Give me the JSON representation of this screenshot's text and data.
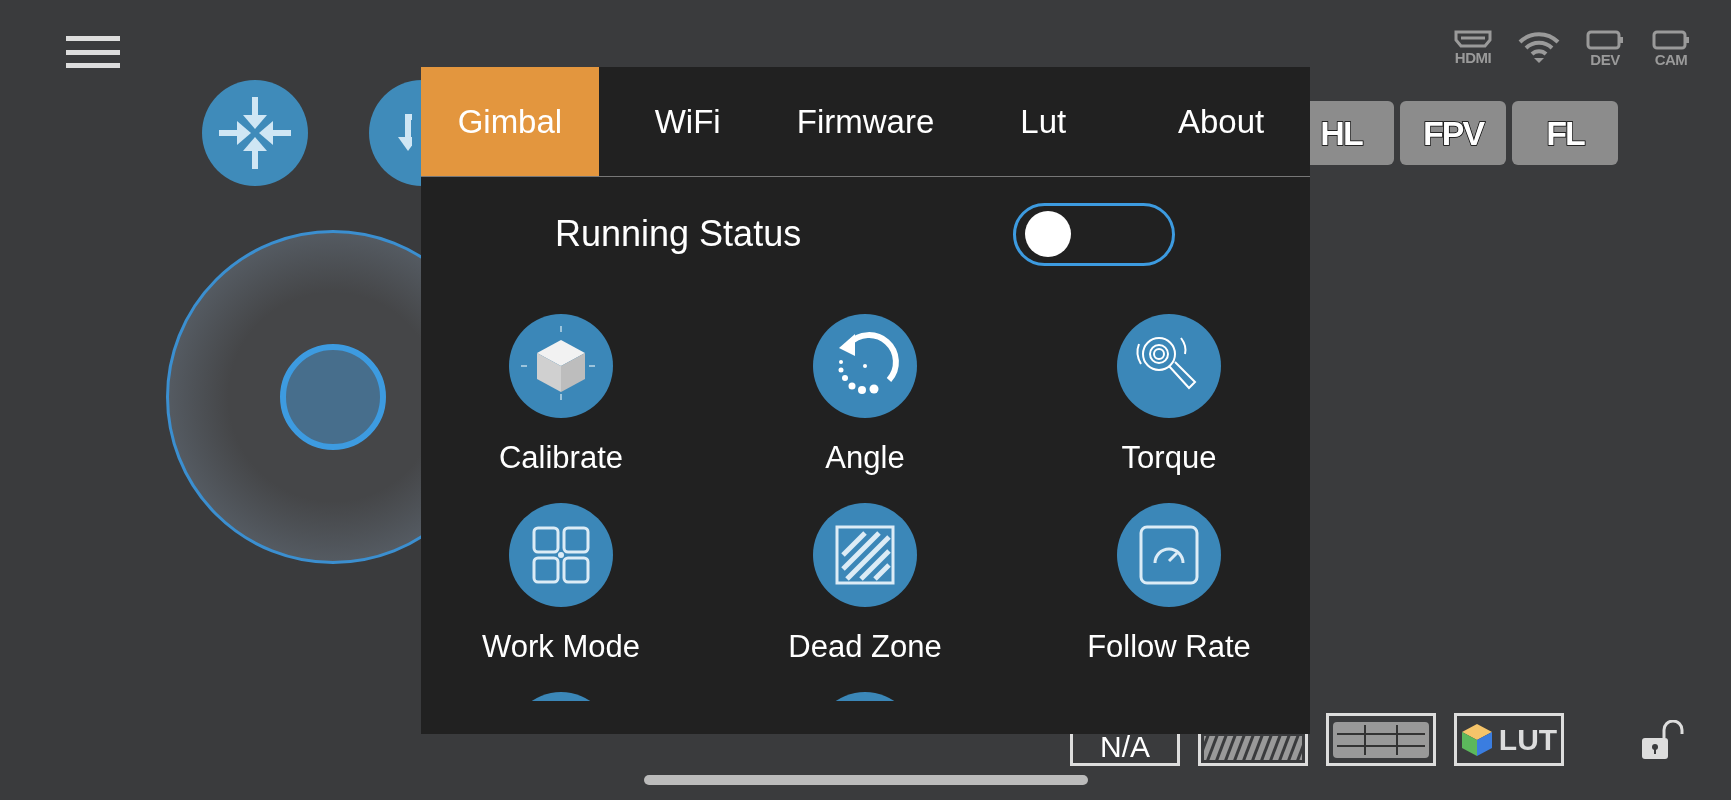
{
  "left_buttons": [
    {
      "kind": "center"
    },
    {
      "kind": "return"
    }
  ],
  "status_icons": [
    {
      "kind": "hdmi",
      "label": "HDMI"
    },
    {
      "kind": "wifi"
    },
    {
      "kind": "battery",
      "label": "DEV"
    },
    {
      "kind": "battery",
      "label": "CAM"
    }
  ],
  "mode_buttons": [
    "HL",
    "FPV",
    "FL"
  ],
  "bottom_tools": [
    {
      "kind": "text",
      "label": "N/A"
    },
    {
      "kind": "hatch"
    },
    {
      "kind": "grid"
    },
    {
      "kind": "lut",
      "label": "LUT"
    }
  ],
  "lock": {
    "locked": false
  },
  "menu": {
    "tabs": [
      {
        "label": "Gimbal",
        "selected": true
      },
      {
        "label": "WiFi",
        "selected": false
      },
      {
        "label": "Firmware",
        "selected": false
      },
      {
        "label": "Lut",
        "selected": false
      },
      {
        "label": "About",
        "selected": false
      }
    ],
    "running_status": {
      "label": "Running Status",
      "on": false
    },
    "items": [
      {
        "kind": "cube",
        "label": "Calibrate"
      },
      {
        "kind": "rotate",
        "label": "Angle"
      },
      {
        "kind": "torque",
        "label": "Torque"
      },
      {
        "kind": "quad",
        "label": "Work Mode"
      },
      {
        "kind": "hatch",
        "label": "Dead Zone"
      },
      {
        "kind": "gauge",
        "label": "Follow Rate"
      },
      {
        "kind": "plain"
      },
      {
        "kind": "plain"
      }
    ]
  }
}
